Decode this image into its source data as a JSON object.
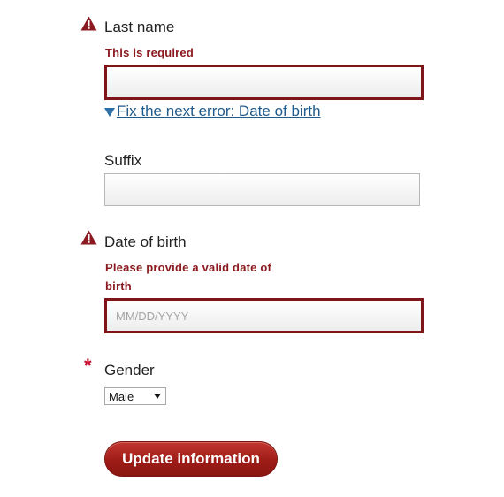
{
  "last_name": {
    "label": "Last name",
    "error": "This is required",
    "value": "",
    "placeholder": "",
    "fix_link": "Fix the next error: Date of birth"
  },
  "suffix": {
    "label": "Suffix",
    "value": "",
    "placeholder": ""
  },
  "date_of_birth": {
    "label": "Date of birth",
    "error_line1": "Please provide a valid date of",
    "error_line2": "birth",
    "value": "",
    "placeholder": "MM/DD/YYYY"
  },
  "gender": {
    "required_marker": "*",
    "label": "Gender",
    "selected": "Male"
  },
  "submit": {
    "label": "Update information"
  },
  "icons": {
    "warning": "warning-triangle-icon",
    "fix_arrow": "triangle-down-icon",
    "select_caret": "chevron-down-icon"
  },
  "colors": {
    "error": "#8a1a1f",
    "error_border": "#7e1518",
    "link": "#1f5a8c",
    "required": "#c8102e",
    "button": "#9e1c17"
  }
}
